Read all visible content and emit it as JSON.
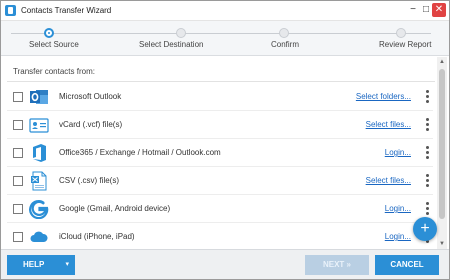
{
  "window": {
    "title": "Contacts Transfer Wizard"
  },
  "window_controls": {
    "minimize": "−",
    "maximize": "□",
    "close": "✕"
  },
  "steps": [
    {
      "label": "Select Source",
      "active": true
    },
    {
      "label": "Select Destination",
      "active": false
    },
    {
      "label": "Confirm",
      "active": false
    },
    {
      "label": "Review Report",
      "active": false
    }
  ],
  "content": {
    "section_label": "Transfer contacts from:"
  },
  "sources": [
    {
      "label": "Microsoft Outlook",
      "action": "Select folders...",
      "icon": "outlook-icon",
      "checked": false
    },
    {
      "label": "vCard (.vcf) file(s)",
      "action": "Select files...",
      "icon": "vcard-icon",
      "checked": false
    },
    {
      "label": "Office365 / Exchange / Hotmail / Outlook.com",
      "action": "Login...",
      "icon": "office365-icon",
      "checked": false
    },
    {
      "label": "CSV (.csv) file(s)",
      "action": "Select files...",
      "icon": "csv-file-icon",
      "checked": false
    },
    {
      "label": "Google (Gmail, Android device)",
      "action": "Login...",
      "icon": "google-icon",
      "checked": false
    },
    {
      "label": "iCloud (iPhone, iPad)",
      "action": "Login...",
      "icon": "icloud-icon",
      "checked": false
    }
  ],
  "fab": {
    "label": "+"
  },
  "footer": {
    "help_label": "HELP",
    "help_caret": "▾",
    "next_label": "NEXT »",
    "cancel_label": "CANCEL"
  },
  "colors": {
    "accent": "#2b8fd6",
    "link": "#1a67c2",
    "disabled": "#b9cfe3"
  }
}
